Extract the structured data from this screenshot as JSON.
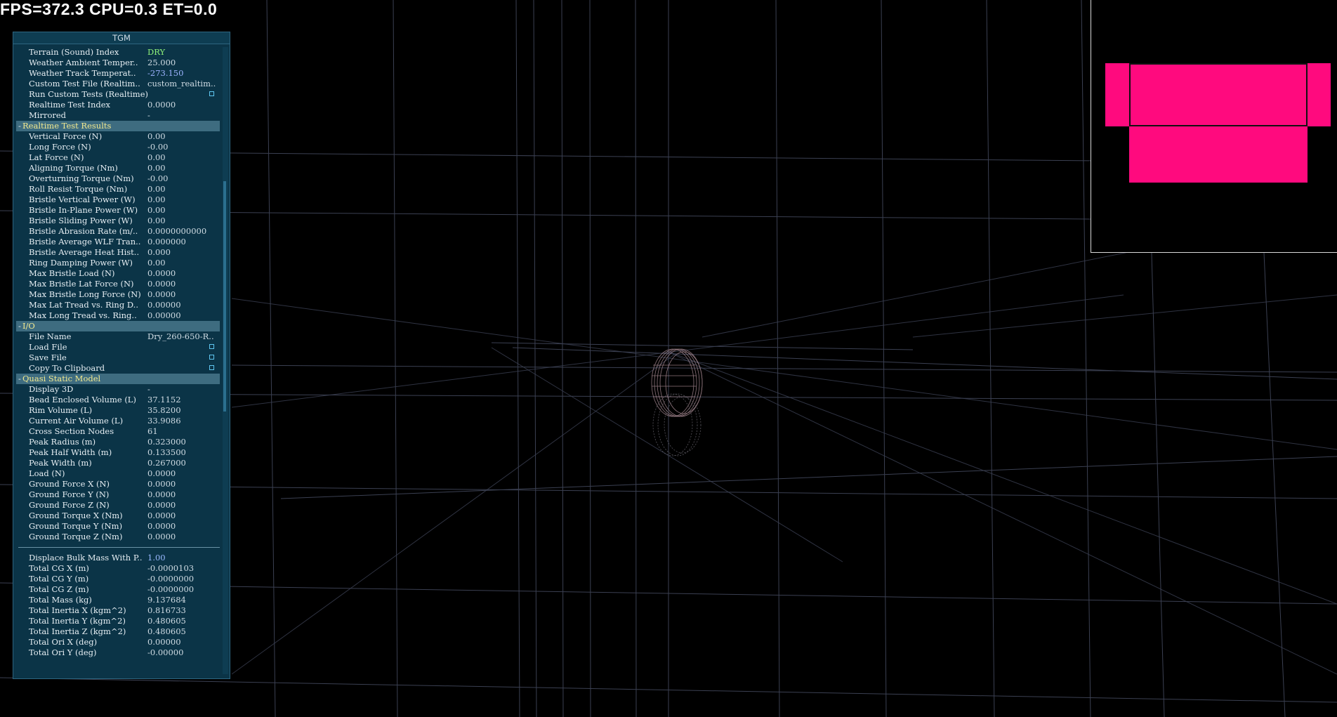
{
  "hud": {
    "stats": "FPS=372.3 CPU=0.3 ET=0.0"
  },
  "panel": {
    "title": "TGM",
    "rows": [
      {
        "type": "item",
        "label": "Terrain (Sound) Index",
        "value": "DRY",
        "tone": "green"
      },
      {
        "type": "item",
        "label": "Weather Ambient Temper..",
        "value": "25.000"
      },
      {
        "type": "item",
        "label": "Weather Track Temperat..",
        "value": "-273.150",
        "tone": "lilac"
      },
      {
        "type": "item",
        "label": "Custom Test File (Realtim..",
        "value": "custom_realtim.."
      },
      {
        "type": "check",
        "label": "Run Custom Tests (Realtime)"
      },
      {
        "type": "item",
        "label": "Realtime Test Index",
        "value": "0.0000"
      },
      {
        "type": "item",
        "label": "Mirrored",
        "value": "-"
      },
      {
        "type": "section",
        "sign": "-",
        "label": "Realtime Test Results"
      },
      {
        "type": "item",
        "label": "Vertical Force (N)",
        "value": "0.00"
      },
      {
        "type": "item",
        "label": "Long Force (N)",
        "value": "-0.00"
      },
      {
        "type": "item",
        "label": "Lat Force (N)",
        "value": "0.00"
      },
      {
        "type": "item",
        "label": "Aligning Torque (Nm)",
        "value": "0.00"
      },
      {
        "type": "item",
        "label": "Overturning Torque (Nm)",
        "value": "-0.00"
      },
      {
        "type": "item",
        "label": "Roll Resist Torque (Nm)",
        "value": "0.00"
      },
      {
        "type": "item",
        "label": "Bristle Vertical Power (W)",
        "value": "0.00"
      },
      {
        "type": "item",
        "label": "Bristle In-Plane Power (W)",
        "value": "0.00"
      },
      {
        "type": "item",
        "label": "Bristle Sliding Power (W)",
        "value": "0.00"
      },
      {
        "type": "item",
        "label": "Bristle Abrasion Rate (m/..",
        "value": "0.0000000000"
      },
      {
        "type": "item",
        "label": "Bristle Average WLF Tran..",
        "value": "0.000000"
      },
      {
        "type": "item",
        "label": "Bristle Average Heat Hist..",
        "value": "0.000"
      },
      {
        "type": "item",
        "label": "Ring Damping Power (W)",
        "value": "0.00"
      },
      {
        "type": "item",
        "label": "Max Bristle Load (N)",
        "value": "0.0000"
      },
      {
        "type": "item",
        "label": "Max Bristle Lat Force (N)",
        "value": "0.0000"
      },
      {
        "type": "item",
        "label": "Max Bristle Long Force (N)",
        "value": "0.0000"
      },
      {
        "type": "item",
        "label": "Max Lat Tread vs. Ring D..",
        "value": "0.00000"
      },
      {
        "type": "item",
        "label": "Max Long Tread vs. Ring..",
        "value": "0.00000"
      },
      {
        "type": "section",
        "sign": "-",
        "label": "I/O"
      },
      {
        "type": "item",
        "label": "File Name",
        "value": "Dry_260-650-R.."
      },
      {
        "type": "check",
        "label": "Load File"
      },
      {
        "type": "check",
        "label": "Save File"
      },
      {
        "type": "check",
        "label": "Copy To Clipboard"
      },
      {
        "type": "section",
        "sign": "-",
        "label": "Quasi Static Model"
      },
      {
        "type": "item",
        "label": "Display 3D",
        "value": "-"
      },
      {
        "type": "item",
        "label": "Bead Enclosed Volume (L)",
        "value": "37.1152"
      },
      {
        "type": "item",
        "label": "Rim Volume (L)",
        "value": "35.8200"
      },
      {
        "type": "item",
        "label": "Current Air Volume (L)",
        "value": "33.9086"
      },
      {
        "type": "item",
        "label": "Cross Section Nodes",
        "value": "61"
      },
      {
        "type": "item",
        "label": "Peak Radius (m)",
        "value": "0.323000"
      },
      {
        "type": "item",
        "label": "Peak Half Width (m)",
        "value": "0.133500"
      },
      {
        "type": "item",
        "label": "Peak Width (m)",
        "value": "0.267000"
      },
      {
        "type": "item",
        "label": "Load (N)",
        "value": "0.0000"
      },
      {
        "type": "item",
        "label": "Ground Force X (N)",
        "value": "0.0000"
      },
      {
        "type": "item",
        "label": "Ground Force Y (N)",
        "value": "0.0000"
      },
      {
        "type": "item",
        "label": "Ground Force Z (N)",
        "value": "0.0000"
      },
      {
        "type": "item",
        "label": "Ground Torque X (Nm)",
        "value": "0.0000"
      },
      {
        "type": "item",
        "label": "Ground Torque Y (Nm)",
        "value": "0.0000"
      },
      {
        "type": "item",
        "label": "Ground Torque Z (Nm)",
        "value": "0.0000"
      },
      {
        "type": "divider"
      },
      {
        "type": "item",
        "label": "Displace Bulk Mass With P..",
        "value": "1.00",
        "tone": "blue"
      },
      {
        "type": "item",
        "label": "Total CG X (m)",
        "value": "-0.0000103"
      },
      {
        "type": "item",
        "label": "Total CG Y (m)",
        "value": "-0.0000000"
      },
      {
        "type": "item",
        "label": "Total CG Z (m)",
        "value": "-0.0000000"
      },
      {
        "type": "item",
        "label": "Total Mass (kg)",
        "value": "9.137684"
      },
      {
        "type": "item",
        "label": "Total Inertia X (kgm^2)",
        "value": "0.816733"
      },
      {
        "type": "item",
        "label": "Total Inertia Y (kgm^2)",
        "value": "0.480605"
      },
      {
        "type": "item",
        "label": "Total Inertia Z (kgm^2)",
        "value": "0.480605"
      },
      {
        "type": "item",
        "label": "Total Ori X (deg)",
        "value": "0.00000"
      },
      {
        "type": "item",
        "label": "Total Ori Y (deg)",
        "value": "-0.00000"
      }
    ]
  },
  "colors": {
    "background": "#000000",
    "panel_bg": "#0b3447",
    "section_bg": "#3e6c80",
    "section_text": "#f2e98f",
    "preview_fill": "#ff0a7e",
    "grid_line": "#3a3f52"
  }
}
